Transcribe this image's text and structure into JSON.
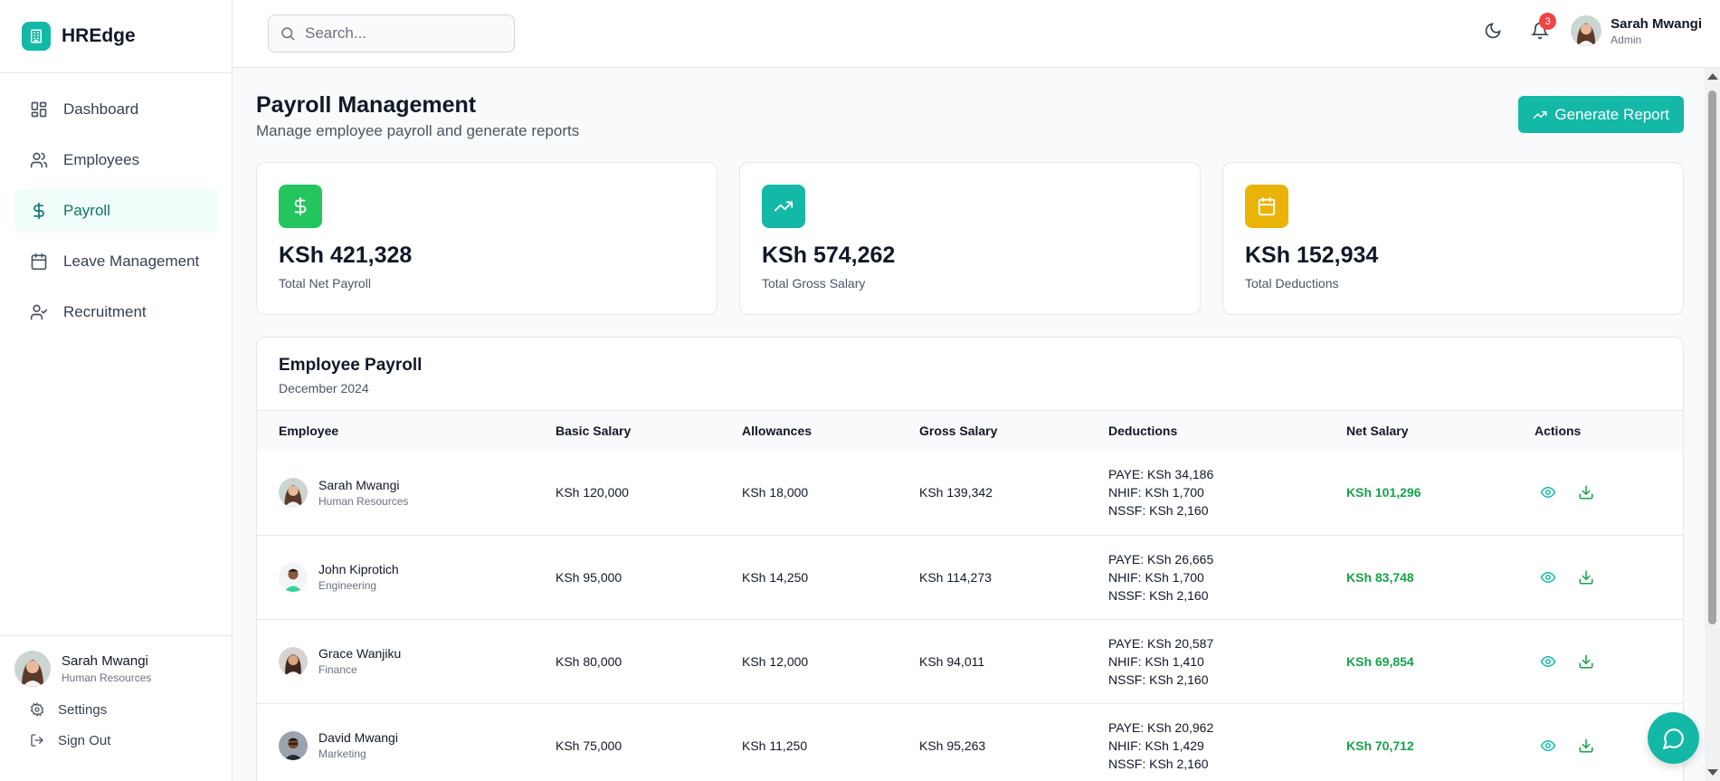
{
  "app": {
    "name": "HREdge"
  },
  "sidebar": {
    "items": [
      {
        "label": "Dashboard",
        "icon": "dashboard-icon",
        "active": false
      },
      {
        "label": "Employees",
        "icon": "users-icon",
        "active": false
      },
      {
        "label": "Payroll",
        "icon": "dollar-icon",
        "active": true
      },
      {
        "label": "Leave Management",
        "icon": "calendar-icon",
        "active": false
      },
      {
        "label": "Recruitment",
        "icon": "user-check-icon",
        "active": false
      }
    ],
    "user": {
      "name": "Sarah Mwangi",
      "role": "Human Resources"
    },
    "settings_label": "Settings",
    "signout_label": "Sign Out"
  },
  "topbar": {
    "search_placeholder": "Search...",
    "notification_count": "3",
    "user": {
      "name": "Sarah Mwangi",
      "role": "Admin"
    }
  },
  "page": {
    "title": "Payroll Management",
    "subtitle": "Manage employee payroll and generate reports",
    "generate_label": "Generate Report"
  },
  "stats": [
    {
      "value": "KSh 421,328",
      "label": "Total Net Payroll",
      "color": "#22c55e",
      "icon": "dollar-icon"
    },
    {
      "value": "KSh 574,262",
      "label": "Total Gross Salary",
      "color": "#14b8a6",
      "icon": "trending-up-icon"
    },
    {
      "value": "KSh 152,934",
      "label": "Total Deductions",
      "color": "#eab308",
      "icon": "calendar-icon"
    }
  ],
  "table": {
    "title": "Employee Payroll",
    "period": "December 2024",
    "columns": [
      "Employee",
      "Basic Salary",
      "Allowances",
      "Gross Salary",
      "Deductions",
      "Net Salary",
      "Actions"
    ],
    "rows": [
      {
        "name": "Sarah Mwangi",
        "dept": "Human Resources",
        "basic": "KSh 120,000",
        "allowances": "KSh 18,000",
        "gross": "KSh 139,342",
        "paye": "PAYE: KSh 34,186",
        "nhif": "NHIF: KSh 1,700",
        "nssf": "NSSF: KSh 2,160",
        "net": "KSh 101,296"
      },
      {
        "name": "John Kiprotich",
        "dept": "Engineering",
        "basic": "KSh 95,000",
        "allowances": "KSh 14,250",
        "gross": "KSh 114,273",
        "paye": "PAYE: KSh 26,665",
        "nhif": "NHIF: KSh 1,700",
        "nssf": "NSSF: KSh 2,160",
        "net": "KSh 83,748"
      },
      {
        "name": "Grace Wanjiku",
        "dept": "Finance",
        "basic": "KSh 80,000",
        "allowances": "KSh 12,000",
        "gross": "KSh 94,011",
        "paye": "PAYE: KSh 20,587",
        "nhif": "NHIF: KSh 1,410",
        "nssf": "NSSF: KSh 2,160",
        "net": "KSh 69,854"
      },
      {
        "name": "David Mwangi",
        "dept": "Marketing",
        "basic": "KSh 75,000",
        "allowances": "KSh 11,250",
        "gross": "KSh 95,263",
        "paye": "PAYE: KSh 20,962",
        "nhif": "NHIF: KSh 1,429",
        "nssf": "NSSF: KSh 2,160",
        "net": "KSh 70,712"
      }
    ]
  },
  "colors": {
    "accent": "#14b8a6",
    "net_salary": "#16a34a",
    "badge": "#ef4444"
  }
}
